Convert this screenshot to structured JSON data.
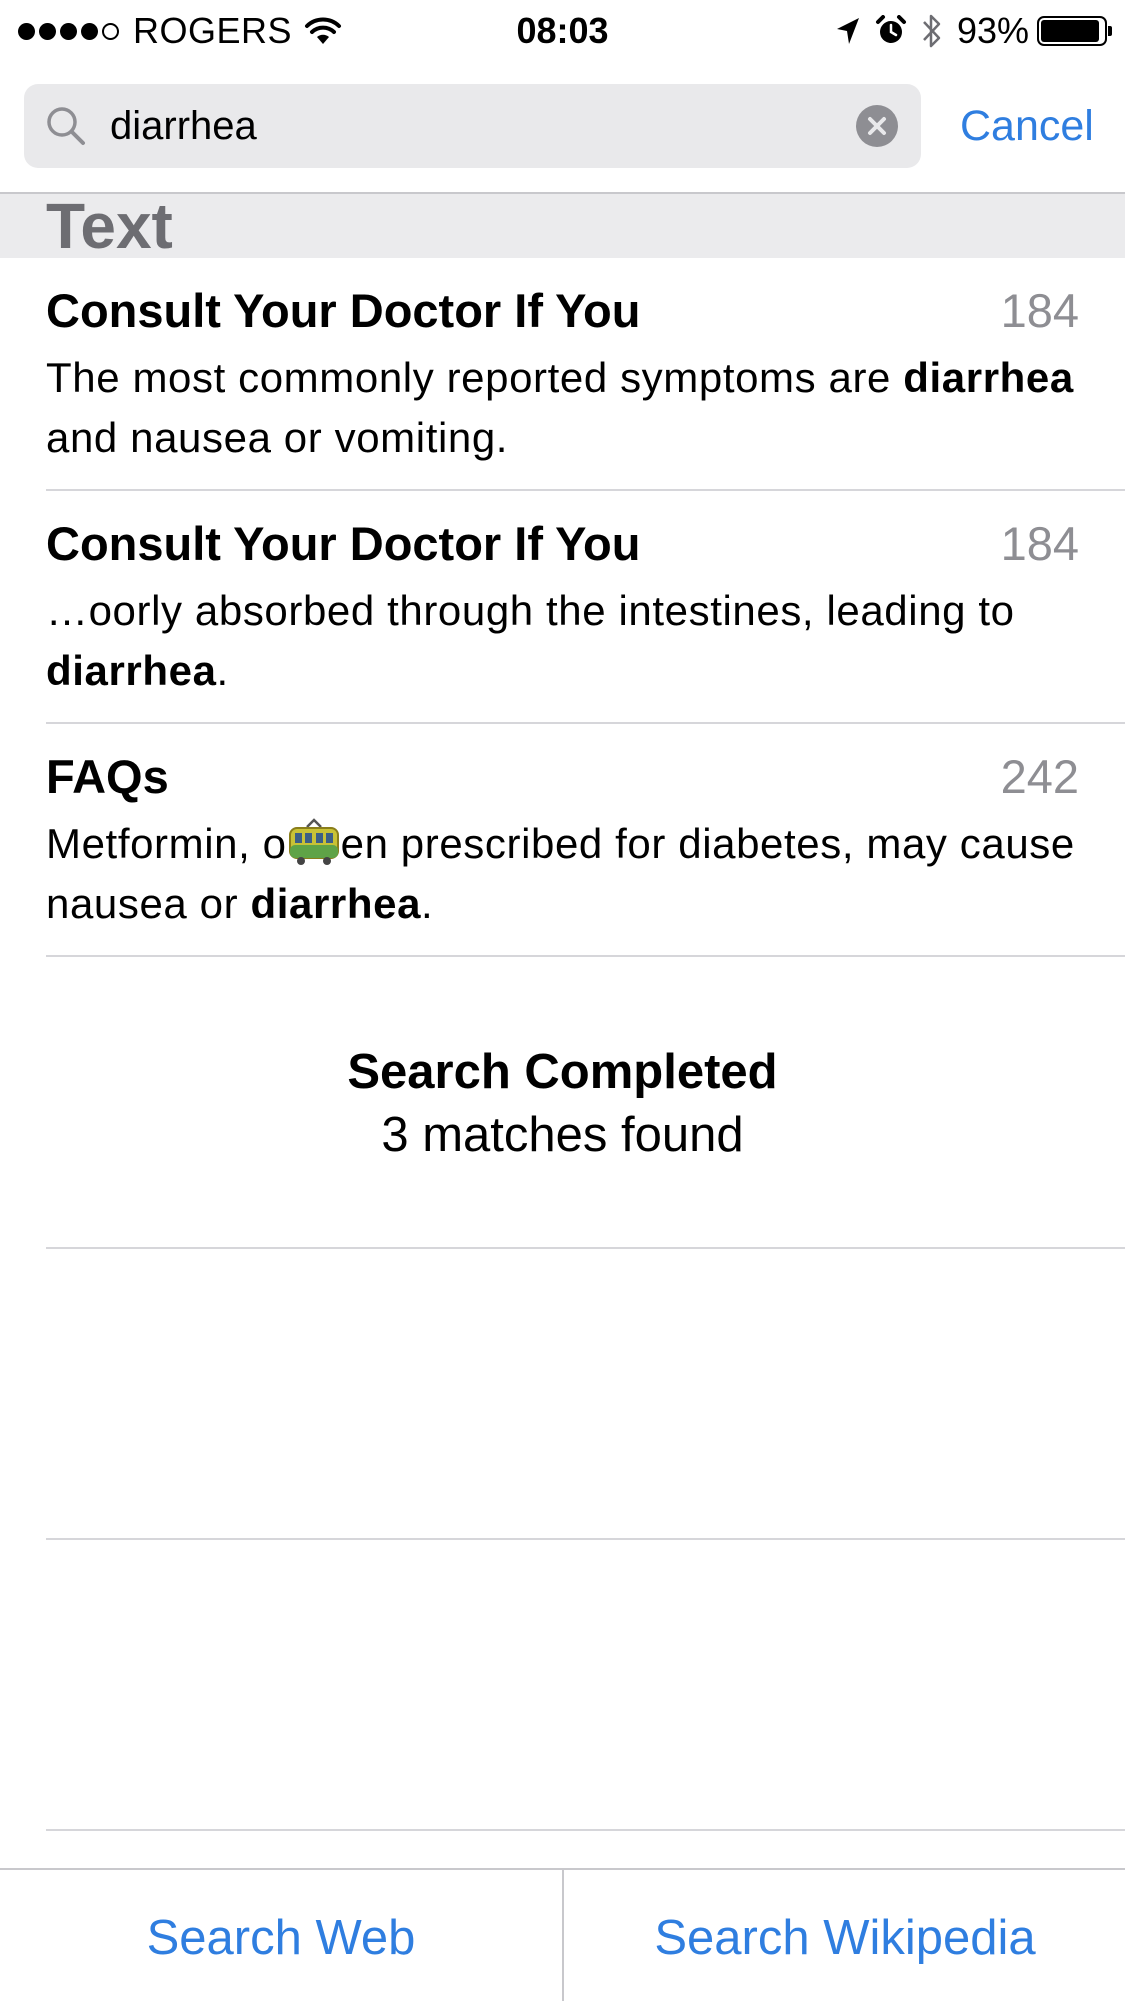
{
  "status_bar": {
    "carrier": "ROGERS",
    "time": "08:03",
    "battery_percent": "93%",
    "battery_level": 0.93,
    "signal_strength": 4,
    "signal_max": 5
  },
  "search": {
    "value": "diarrhea",
    "cancel_label": "Cancel"
  },
  "section": {
    "title": "Text"
  },
  "results": [
    {
      "title": "Consult Your Doctor If You",
      "page": "184",
      "snippet_before": "The most commonly reported symptoms are ",
      "snippet_match": "diarrhea",
      "snippet_after": " and nausea or vomiting."
    },
    {
      "title": "Consult Your Doctor If You",
      "page": "184",
      "snippet_before": "…oorly absorbed through the intestines, leading to ",
      "snippet_match": "diarrhea",
      "snippet_after": "."
    },
    {
      "title": "FAQs",
      "page": "242",
      "snippet_before_a": "Metformin, o",
      "snippet_before_b": "en prescribed for diabetes, may cause nausea or ",
      "snippet_match": "diarrhea",
      "snippet_after": "."
    }
  ],
  "completion": {
    "title": "Search Completed",
    "count": "3 matches found"
  },
  "toolbar": {
    "search_web_label": "Search Web",
    "search_wikipedia_label": "Search Wikipedia"
  },
  "colors": {
    "accent": "#2f7ee0",
    "secondary_text": "#8e8e93",
    "section_background": "#ebebed",
    "search_field_background": "#e9e9eb"
  },
  "icons": {
    "search": "magnifier-icon",
    "clear": "clear-circle-icon",
    "wifi": "wifi-icon",
    "location": "location-arrow-icon",
    "alarm": "alarm-clock-icon",
    "bluetooth": "bluetooth-icon",
    "battery": "battery-icon",
    "inline_emoji": "tram-icon"
  }
}
